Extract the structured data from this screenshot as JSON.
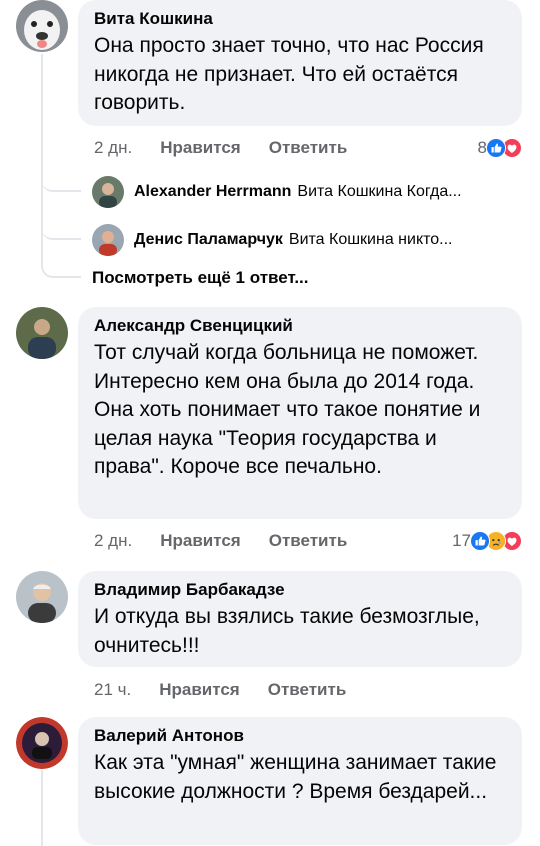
{
  "comments": [
    {
      "author": "Вита Кошкина",
      "text": "Она просто знает точно, что нас Россия никогда не признает. Что ей остаётся говорить.",
      "time": "2 дн.",
      "like": "Нравится",
      "reply": "Ответить",
      "reactions": {
        "count": "8",
        "icons": [
          "like-icon",
          "love-icon"
        ]
      },
      "sub_replies": [
        {
          "author": "Alexander Herrmann",
          "text": "Вита Кошкина Когда..."
        },
        {
          "author": "Денис Паламарчук",
          "text": "Вита Кошкина никто..."
        }
      ],
      "more_replies": "Посмотреть ещё 1 ответ..."
    },
    {
      "author": "Александр Свенцицкий",
      "text": "Тот случай когда больница не поможет. Интересно кем она была до 2014 года. Она хоть понимает что такое понятие и целая наука \"Теория государства и права\". Короче все печально.",
      "time": "2 дн.",
      "like": "Нравится",
      "reply": "Ответить",
      "reactions": {
        "count": "17",
        "icons": [
          "like-icon",
          "sad-icon",
          "love-icon"
        ]
      }
    },
    {
      "author": "Владимир Барбакадзе",
      "text": "И откуда вы взялись такие безмозглые, очнитесь!!!",
      "time": "21 ч.",
      "like": "Нравится",
      "reply": "Ответить"
    },
    {
      "author": "Валерий Антонов",
      "text": "Как эта \"умная\" женщина занимает такие высокие должности ? Время бездарей..."
    }
  ],
  "colors": {
    "bubble": "#f0f2f5",
    "meta": "#65676b",
    "like": "#1877f2",
    "love": "#f33e58",
    "sad": "#f7b125"
  }
}
